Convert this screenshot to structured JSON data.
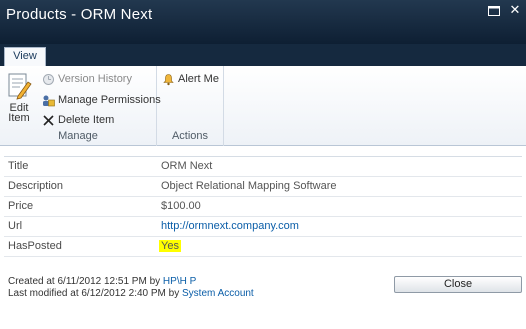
{
  "dialog": {
    "title": "Products - ORM Next"
  },
  "tabs": [
    {
      "label": "View"
    }
  ],
  "ribbon": {
    "edit_item": "Edit Item",
    "version_history": "Version History",
    "manage_permissions": "Manage Permissions",
    "delete_item": "Delete Item",
    "alert_me": "Alert Me",
    "group_manage": "Manage",
    "group_actions": "Actions"
  },
  "fields": [
    {
      "label": "Title",
      "value": "ORM Next"
    },
    {
      "label": "Description",
      "value": "Object Relational Mapping Software"
    },
    {
      "label": "Price",
      "value": "$100.00"
    },
    {
      "label": "Url",
      "value": "http://ormnext.company.com"
    },
    {
      "label": "HasPosted",
      "value": "Yes"
    }
  ],
  "footer": {
    "created_prefix": "Created at 6/11/2012 12:51 PM by",
    "created_by": "HP\\H P",
    "modified_prefix": "Last modified at 6/12/2012 2:40 PM by",
    "modified_by": "System Account"
  },
  "buttons": {
    "close": "Close"
  },
  "colors": {
    "titlebar": "#1a2f45",
    "link": "#0b5ea8",
    "highlight": "#ffff00"
  }
}
